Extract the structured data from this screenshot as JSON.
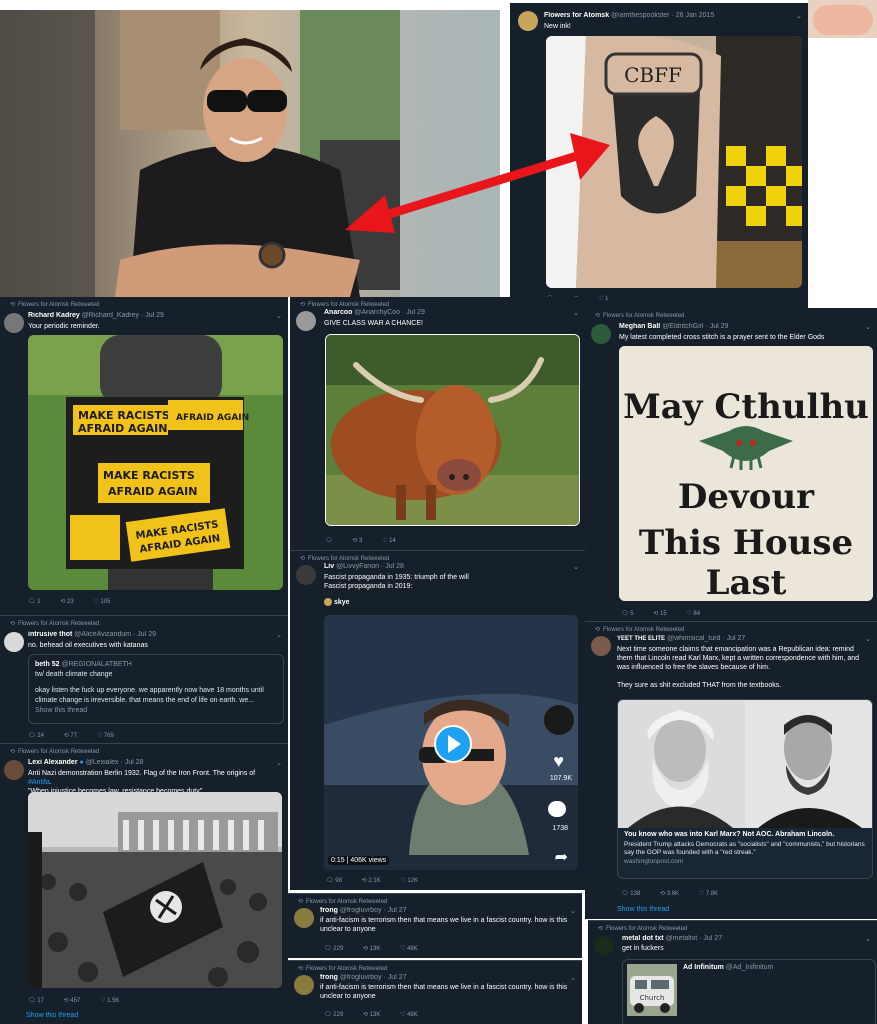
{
  "colors": {
    "panel_bg": "#15202b",
    "link": "#1da1f2",
    "muted": "#8899a6",
    "arrow": "#e8161b"
  },
  "tattoo_tweet": {
    "name": "Flowers for Atomsk",
    "handle": "@iamthespookster · 26 Jan 2015",
    "text": "New ink!",
    "tattoo_text": "CBFF",
    "likes": "1"
  },
  "kadrey": {
    "rt": "Flowers for Atomsk Retweeted",
    "name": "Richard Kadrey",
    "handle": "@Richard_Kadrey · Jul 29",
    "text": "Your periodic reminder.",
    "stickers": [
      "MAKE RACISTS",
      "AFRAID AGAIN",
      "MAKE RACISTS",
      "AFRAID AGAIN",
      "MAKE RACISTS",
      "AFRAID AGAIN"
    ],
    "replies": "1",
    "retweets": "23",
    "likes": "105"
  },
  "anarcoo": {
    "rt": "Flowers for Atomsk Retweeted",
    "name": "Anarcoo",
    "handle": "@AnarchyCoo · Jul 29",
    "text": "GIVE CLASS WAR A CHANCE!",
    "replies": "",
    "retweets": "3",
    "likes": "14"
  },
  "meghan": {
    "rt": "Flowers for Atomsk Retweeted",
    "name": "Meghan Ball",
    "handle": "@EldritchGirl · Jul 29",
    "text": "My latest completed cross stitch is a prayer sent to the Elder Gods",
    "stitch": [
      "May Cthulhu",
      "Devour",
      "This House",
      "Last"
    ],
    "replies": "5",
    "retweets": "15",
    "likes": "84"
  },
  "liv": {
    "rt": "Flowers for Atomsk Retweeted",
    "name": "Liv",
    "handle": "@LivvyFanon · Jul 28",
    "text1": "Fascist propaganda in 1935: triumph of the will",
    "text2": "Fascist propaganda in 2019:",
    "sub": "skye",
    "time": "0:15",
    "views": "406K views",
    "likes_overlay": "107.9K",
    "comments_overlay": "1738",
    "replies": "98",
    "retweets": "2.1K",
    "likes": "12K"
  },
  "intrusive": {
    "rt": "Flowers for Atomsk Retweeted",
    "name": "intrusive thot",
    "handle": "@AliceAvizandum · Jul 29",
    "text": "no. behead oil executives with katanas",
    "q_name": "beth 52",
    "q_handle": "@REGIONALATBETH",
    "q_line1": "tw/ death climate change",
    "q_line2": "okay listen the fuck up everyone. we apparently now have 18 months until climate change is irreversible. that means the end of life on earth. we...",
    "q_show": "Show this thread",
    "replies": "24",
    "retweets": "77",
    "likes": "769"
  },
  "yeet": {
    "rt": "Flowers for Atomsk Retweeted",
    "name": "YEET THE ELITE",
    "handle": "@whimsical_turd · Jul 27",
    "text": "Next time someone claims that emancipation was a Republican idea: remind them that Lincoln read Karl Marx, kept a written correspondence with him, and was influenced to free the slaves because of him.",
    "text2": "They sure as shit excluded THAT from the textbooks.",
    "card_title": "You know who was into Karl Marx? Not AOC. Abraham Lincoln.",
    "card_desc": "President Trump attacks Democrats as \"socialists\" and \"communists,\" but historians say the GOP was founded with a \"red streak.\"",
    "card_domain": "washingtonpost.com",
    "replies": "138",
    "retweets": "3.6K",
    "likes": "7.8K",
    "show": "Show this thread"
  },
  "lexi": {
    "rt": "Flowers for Atomsk Retweeted",
    "name": "Lexi Alexander",
    "handle": "@Lexialex · Jul 28",
    "text1": "Anti Nazi demonstration Berlin 1932. Flag of the Iron Front. The origins of ",
    "link": "#Antifa",
    "text1_end": ".",
    "text2": "\"When injustice becomes law, resistance becomes duty\"",
    "replies": "17",
    "retweets": "457",
    "likes": "1.5K",
    "show": "Show this thread"
  },
  "frong1": {
    "rt": "Flowers for Atomsk Retweeted",
    "name": "frong",
    "handle": "@frogluvrboy · Jul 27",
    "text": "if anti-facism is terrorism then that means we live in a fascist country. how is this unclear to anyone",
    "replies": "229",
    "retweets": "13K",
    "likes": "48K"
  },
  "frong2": {
    "rt": "Flowers for Atomsk Retweeted",
    "name": "frong",
    "handle": "@frogluvrboy · Jul 27",
    "text": "if anti-facism is terrorism then that means we live in a fascist country. how is this unclear to anyone",
    "replies": "229",
    "retweets": "13K",
    "likes": "48K"
  },
  "metal": {
    "rt": "Flowers for Atomsk Retweeted",
    "name": "metal dot txt",
    "handle": "@metaltxt · Jul 27",
    "text": "get in fuckers",
    "q_name": "Ad Infinitum",
    "q_handle": "@Ad_Inifinitum",
    "van_text": "Church"
  }
}
